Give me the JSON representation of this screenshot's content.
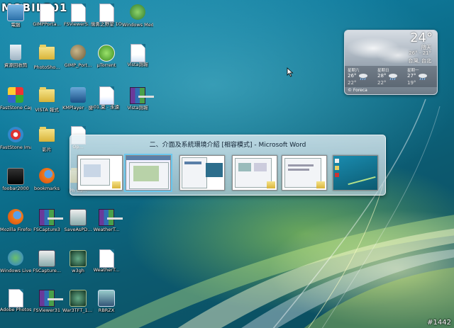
{
  "watermark": {
    "brand": "MOBILE01",
    "photo_number": "#1442"
  },
  "desktop_icons": [
    {
      "label": "電腦",
      "icon": "computer-icon"
    },
    {
      "label": "GIMPPorta...",
      "icon": "text-file-icon"
    },
    {
      "label": "FSViewerS...",
      "icon": "text-file-icon"
    },
    {
      "label": "儒勇之野望 1O2D改.w3x",
      "icon": "text-file-icon"
    },
    {
      "label": "Windows Media Ce...",
      "icon": "media-center-icon"
    },
    {
      "label": "資源回收筒",
      "icon": "recycle-bin-icon"
    },
    {
      "label": "PhotoSho...",
      "icon": "folder-icon"
    },
    {
      "label": "GIMP_Port...",
      "icon": "gimp-icon"
    },
    {
      "label": "µTorrent",
      "icon": "utorrent-icon"
    },
    {
      "label": "Vista測報",
      "icon": "word-doc-icon"
    },
    {
      "label": "FastStone Capture",
      "icon": "faststone-capture-icon"
    },
    {
      "label": "VISTA 報式",
      "icon": "folder-icon"
    },
    {
      "label": "KMPlayer - 捷徑",
      "icon": "kmplayer-icon"
    },
    {
      "label": "01.夏 - 永遠",
      "icon": "mp3-file-icon"
    },
    {
      "label": "Vista測報",
      "icon": "rar-archive-icon"
    },
    {
      "label": "FastStone Image ...",
      "icon": "faststone-image-icon"
    },
    {
      "label": "影片",
      "icon": "folder-icon"
    },
    {
      "label": "Op...",
      "icon": "text-file-icon"
    },
    {
      "label": "foobar2000",
      "icon": "foobar-icon"
    },
    {
      "label": "bookmarks",
      "icon": "firefox-icon"
    },
    {
      "label": "Ph CS...",
      "icon": "folder-icon"
    },
    {
      "label": "Mozilla Firefox",
      "icon": "firefox-icon"
    },
    {
      "label": "FSCapture3",
      "icon": "rar-archive-icon"
    },
    {
      "label": "SaveAsPD...",
      "icon": "installer-icon"
    },
    {
      "label": "WeatherT...",
      "icon": "rar-archive-icon"
    },
    {
      "label": "Windows Live Mes...",
      "icon": "messenger-icon"
    },
    {
      "label": "FSCapture...",
      "icon": "installer-icon"
    },
    {
      "label": "w3gh",
      "icon": "warcraft-icon"
    },
    {
      "label": "WeatherT...",
      "icon": "text-file-icon"
    },
    {
      "label": "Adobe Photoshop...",
      "icon": "text-file-icon"
    },
    {
      "label": "FSViewer31",
      "icon": "rar-archive-icon"
    },
    {
      "label": "War3TFT_1... 捷徑",
      "icon": "warcraft-icon"
    },
    {
      "label": "RBRZX",
      "icon": "app-icon"
    }
  ],
  "weather_gadget": {
    "temperature": "24°",
    "condition": "陰天",
    "range": "26° - 21°",
    "city": "台灣, 台北",
    "forecast": [
      {
        "day": "星期六",
        "high": "26°",
        "low": "22°"
      },
      {
        "day": "星期日",
        "high": "28°",
        "low": "22°"
      },
      {
        "day": "星期一",
        "high": "27°",
        "low": "19°"
      }
    ],
    "provider": "© Foreca"
  },
  "alt_tab": {
    "active_title": "二、介面及系統環境介紹 [相容模式] - Microsoft Word",
    "windows": [
      {
        "name": "window-thumb-1",
        "selected": false
      },
      {
        "name": "window-thumb-2",
        "selected": true
      },
      {
        "name": "window-thumb-3",
        "selected": false
      },
      {
        "name": "window-thumb-4",
        "selected": false
      },
      {
        "name": "window-thumb-5",
        "selected": false
      },
      {
        "name": "window-thumb-6",
        "selected": false
      }
    ]
  }
}
